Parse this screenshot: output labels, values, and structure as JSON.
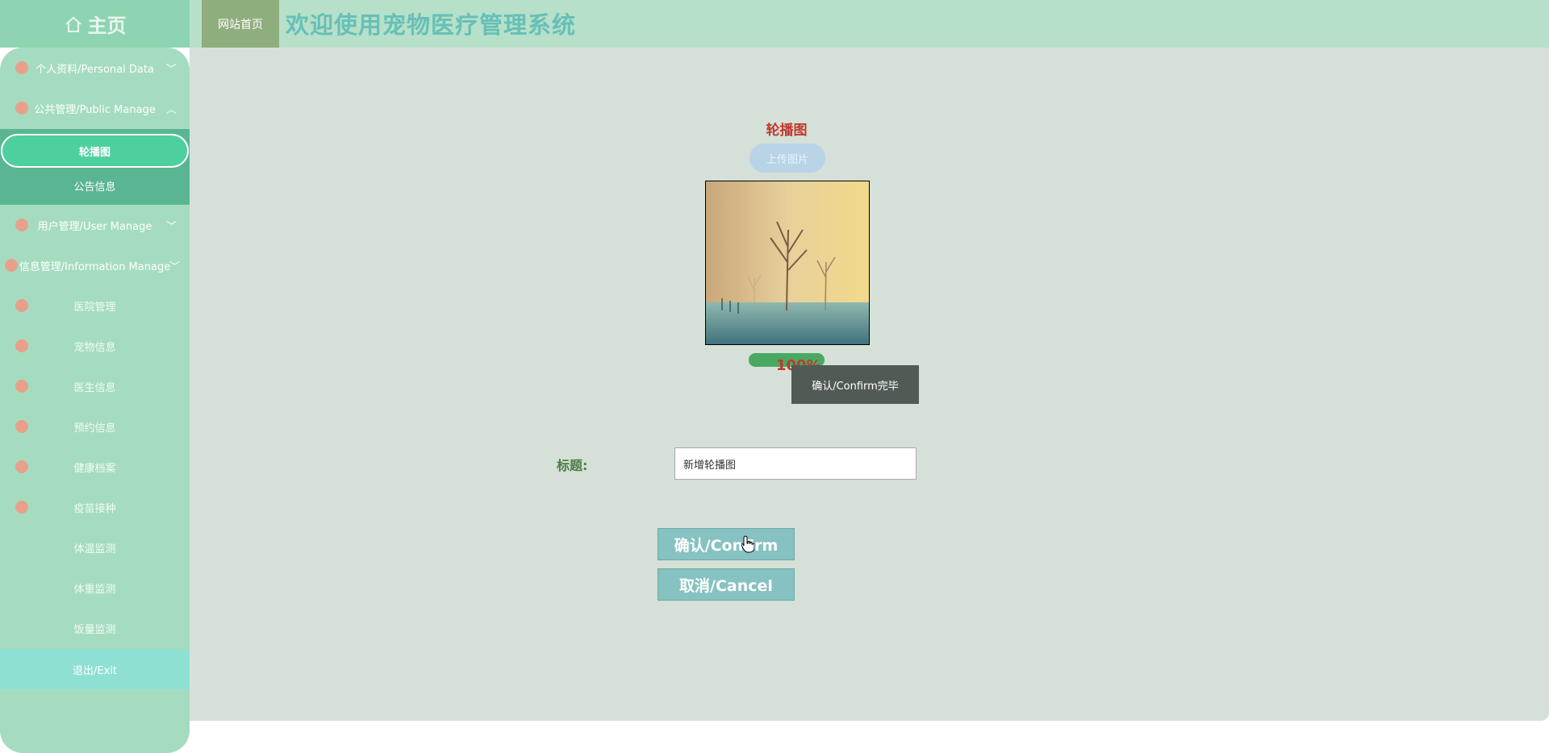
{
  "header": {
    "home_logo": "主页",
    "nav_home": "网站首页",
    "title": "欢迎使用宠物医疗管理系统"
  },
  "sidebar": {
    "personal": "个人资料/Personal Data",
    "public": "公共管理/Public Manage",
    "public_children": [
      "轮播图",
      "公告信息"
    ],
    "user": "用户管理/User Manage",
    "information": "信息管理/Information Manage",
    "info_children": [
      "医院管理",
      "宠物信息",
      "医生信息",
      "预约信息",
      "健康档案",
      "疫苗接种",
      "体温监测",
      "体重监测",
      "饭量监测"
    ],
    "exit": "退出/Exit"
  },
  "form": {
    "section_title": "轮播图",
    "upload_label": "上传图片",
    "progress_text": "100%",
    "progress_value": 1.0,
    "tooltip": "确认/Confirm完毕",
    "title_label": "标题:",
    "title_value": "新增轮播图",
    "confirm_label": "确认/Confirm",
    "cancel_label": "取消/Cancel"
  },
  "colors": {
    "accent": "#4ecf9e",
    "title_color": "#66c0b8",
    "red_text": "#c0392b"
  }
}
